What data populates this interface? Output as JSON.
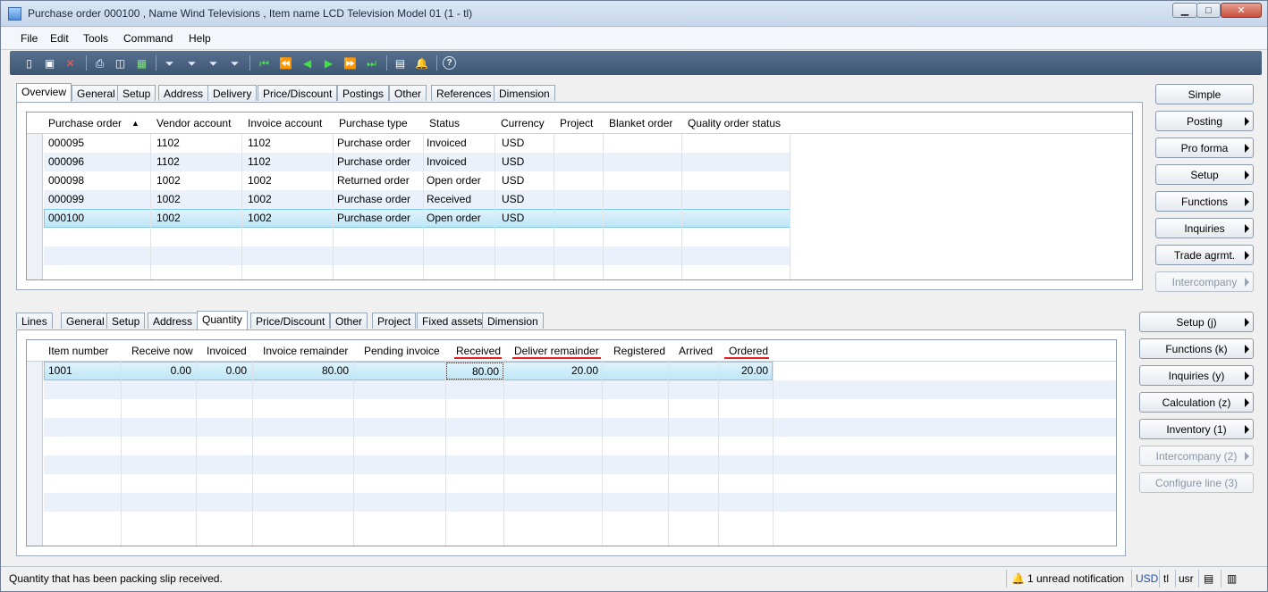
{
  "window": {
    "title": "Purchase order 000100 , Name Wind Televisions , Item name LCD Television Model 01 (1 - tl)"
  },
  "menu": [
    "File",
    "Edit",
    "Tools",
    "Command",
    "Help"
  ],
  "header_tabs": [
    "Overview",
    "General",
    "Setup",
    "Address",
    "Delivery",
    "Price/Discount",
    "Postings",
    "Other",
    "References",
    "Dimension"
  ],
  "orders": {
    "columns": [
      "Purchase order",
      "Vendor account",
      "Invoice account",
      "Purchase type",
      "Status",
      "Currency",
      "Project",
      "Blanket order",
      "Quality order status"
    ],
    "rows": [
      [
        "000095",
        "1102",
        "1102",
        "Purchase order",
        "Invoiced",
        "USD"
      ],
      [
        "000096",
        "1102",
        "1102",
        "Purchase order",
        "Invoiced",
        "USD"
      ],
      [
        "000098",
        "1002",
        "1002",
        "Returned order",
        "Open order",
        "USD"
      ],
      [
        "000099",
        "1002",
        "1002",
        "Purchase order",
        "Received",
        "USD"
      ],
      [
        "000100",
        "1002",
        "1002",
        "Purchase order",
        "Open order",
        "USD"
      ]
    ]
  },
  "header_buttons": [
    "Simple",
    "Posting",
    "Pro forma",
    "Setup",
    "Functions",
    "Inquiries",
    "Trade agrmt.",
    "Intercompany"
  ],
  "line_tabs": [
    "Lines",
    "General",
    "Setup",
    "Address",
    "Quantity",
    "Price/Discount",
    "Other",
    "Project",
    "Fixed assets",
    "Dimension"
  ],
  "lines": {
    "columns": [
      "Item number",
      "Receive now",
      "Invoiced",
      "Invoice remainder",
      "Pending invoice",
      "Received",
      "Deliver remainder",
      "Registered",
      "Arrived",
      "Ordered"
    ],
    "row": {
      "item": "1001",
      "receive_now": "0.00",
      "invoiced": "0.00",
      "invoice_remainder": "80.00",
      "received": "80.00",
      "deliver_remainder": "20.00",
      "ordered": "20.00"
    }
  },
  "line_buttons": [
    "Setup (j)",
    "Functions (k)",
    "Inquiries (y)",
    "Calculation (z)",
    "Inventory (1)",
    "Intercompany (2)",
    "Configure line (3)"
  ],
  "status": {
    "message": "Quantity that has been packing slip received.",
    "notification": "1 unread notification",
    "currency": "USD",
    "company": "tl",
    "layer": "usr"
  },
  "colors": {
    "selected_row": "#bfe6f7",
    "toolbar": "#4a6483",
    "highlight_underline": "#e32020"
  }
}
